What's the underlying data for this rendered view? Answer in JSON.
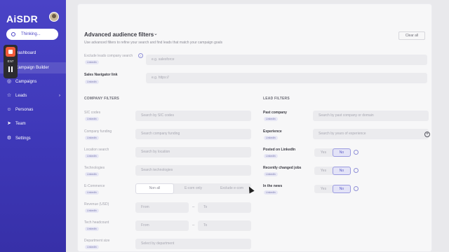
{
  "app": {
    "logo": "AiSDR",
    "thinking_label": "Thinking..."
  },
  "recorder": {
    "time": "0:57"
  },
  "sidebar": {
    "items": [
      {
        "label": "Dashboard",
        "icon": "dashboard-icon"
      },
      {
        "label": "Campaign Builder",
        "icon": "builder-icon",
        "active": true
      },
      {
        "label": "Campaigns",
        "icon": "campaigns-icon"
      },
      {
        "label": "Leads",
        "icon": "star-icon",
        "chevron": "›"
      },
      {
        "label": "Personas",
        "icon": "personas-icon"
      },
      {
        "label": "Team",
        "icon": "send-icon"
      },
      {
        "label": "Settings",
        "icon": "gear-icon"
      }
    ]
  },
  "panel": {
    "title": "Advanced audience filters",
    "subtitle": "Use advanced filters to refine your search and find leads that match your campaign goals",
    "clear_all": "Clear all",
    "exclude_company": {
      "label": "Exclude leads company search",
      "badge": "LinkedIn",
      "placeholder": "e.g. salesforce"
    },
    "sales_navigator": {
      "label": "Sales Navigator link",
      "badge": "LinkedIn",
      "placeholder": "e.g. https://"
    },
    "company_filters": {
      "heading": "COMPANY FILTERS",
      "rows": [
        {
          "label": "SIC codes",
          "badge": "LinkedIn",
          "placeholder": "Search by SIC codes"
        },
        {
          "label": "Company funding",
          "badge": "LinkedIn",
          "placeholder": "Search company funding"
        },
        {
          "label": "Location search",
          "badge": "LinkedIn",
          "placeholder": "Search by location"
        },
        {
          "label": "Technologies",
          "badge": "LinkedIn",
          "placeholder": "Search technologies"
        }
      ],
      "ecommerce": {
        "label": "E-Commerce",
        "badge": "LinkedIn",
        "options": [
          "Non all",
          "E-com only",
          "Exclude e-com"
        ]
      },
      "revenue": {
        "label": "Revenue (USD)",
        "badge": "LinkedIn",
        "from": "From",
        "to": "To",
        "dash": "–"
      },
      "headcount": {
        "label": "Tech headcount",
        "badge": "LinkedIn",
        "from": "From",
        "to": "To",
        "dash": "–"
      },
      "department": {
        "label": "Department size",
        "badge": "LinkedIn",
        "placeholder": "Select by department"
      }
    },
    "lead_filters": {
      "heading": "LEAD FILTERS",
      "past_company": {
        "label": "Past company",
        "badge": "LinkedIn",
        "placeholder": "Search by past company or domain"
      },
      "experience": {
        "label": "Experience",
        "badge": "LinkedIn",
        "placeholder": "Search by years of experience"
      },
      "toggles": [
        {
          "label": "Posted on LinkedIn",
          "badge": "LinkedIn",
          "yes": "Yes",
          "no": "No",
          "selected": "no"
        },
        {
          "label": "Recently changed jobs",
          "badge": "LinkedIn",
          "yes": "Yes",
          "no": "No",
          "selected": "no"
        },
        {
          "label": "In the news",
          "badge": "LinkedIn",
          "yes": "Yes",
          "no": "No",
          "selected": "no"
        }
      ]
    }
  }
}
